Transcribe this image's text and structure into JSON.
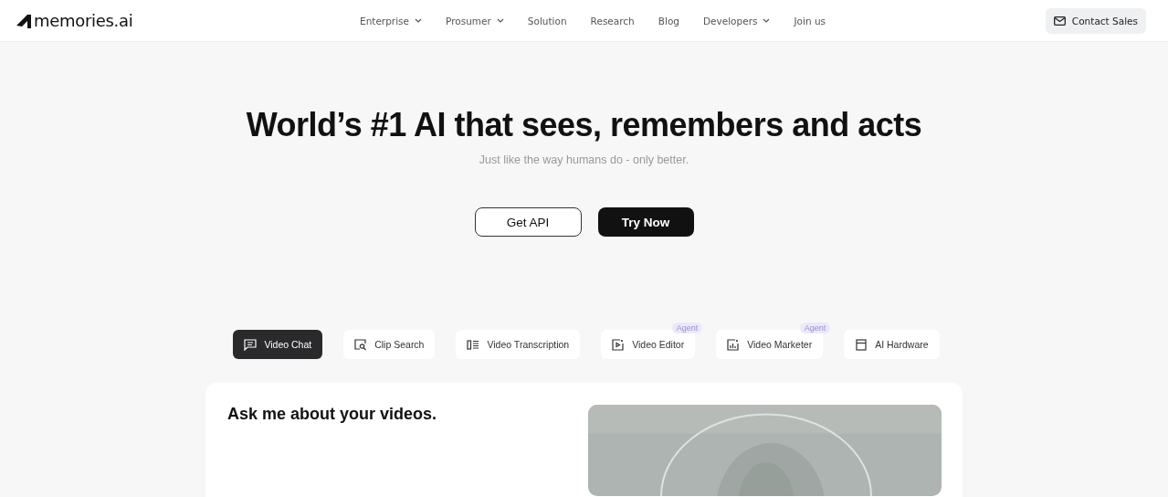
{
  "logo": "memories.ai",
  "nav": [
    {
      "label": "Enterprise",
      "dropdown": true
    },
    {
      "label": "Prosumer",
      "dropdown": true
    },
    {
      "label": "Solution",
      "dropdown": false
    },
    {
      "label": "Research",
      "dropdown": false
    },
    {
      "label": "Blog",
      "dropdown": false
    },
    {
      "label": "Developers",
      "dropdown": true
    },
    {
      "label": "Join us",
      "dropdown": false
    }
  ],
  "contact_button": "Contact Sales",
  "hero": {
    "title": "World’s #1 AI that sees, remembers and acts",
    "subtitle": "Just like the way humans do - only better.",
    "buttons": [
      {
        "label": "Get API",
        "kind": "outline"
      },
      {
        "label": "Try Now",
        "kind": "solid"
      }
    ]
  },
  "tabs": [
    {
      "label": "Video Chat",
      "selected": true
    },
    {
      "label": "Clip Search",
      "selected": false
    },
    {
      "label": "Video Transcription",
      "selected": false
    },
    {
      "label": "Video Editor",
      "selected": false,
      "badge": "Agent"
    },
    {
      "label": "Video Marketer",
      "selected": false,
      "badge": "Agent"
    },
    {
      "label": "AI Hardware",
      "selected": false
    }
  ],
  "panel": {
    "heading": "Ask me about your videos."
  }
}
